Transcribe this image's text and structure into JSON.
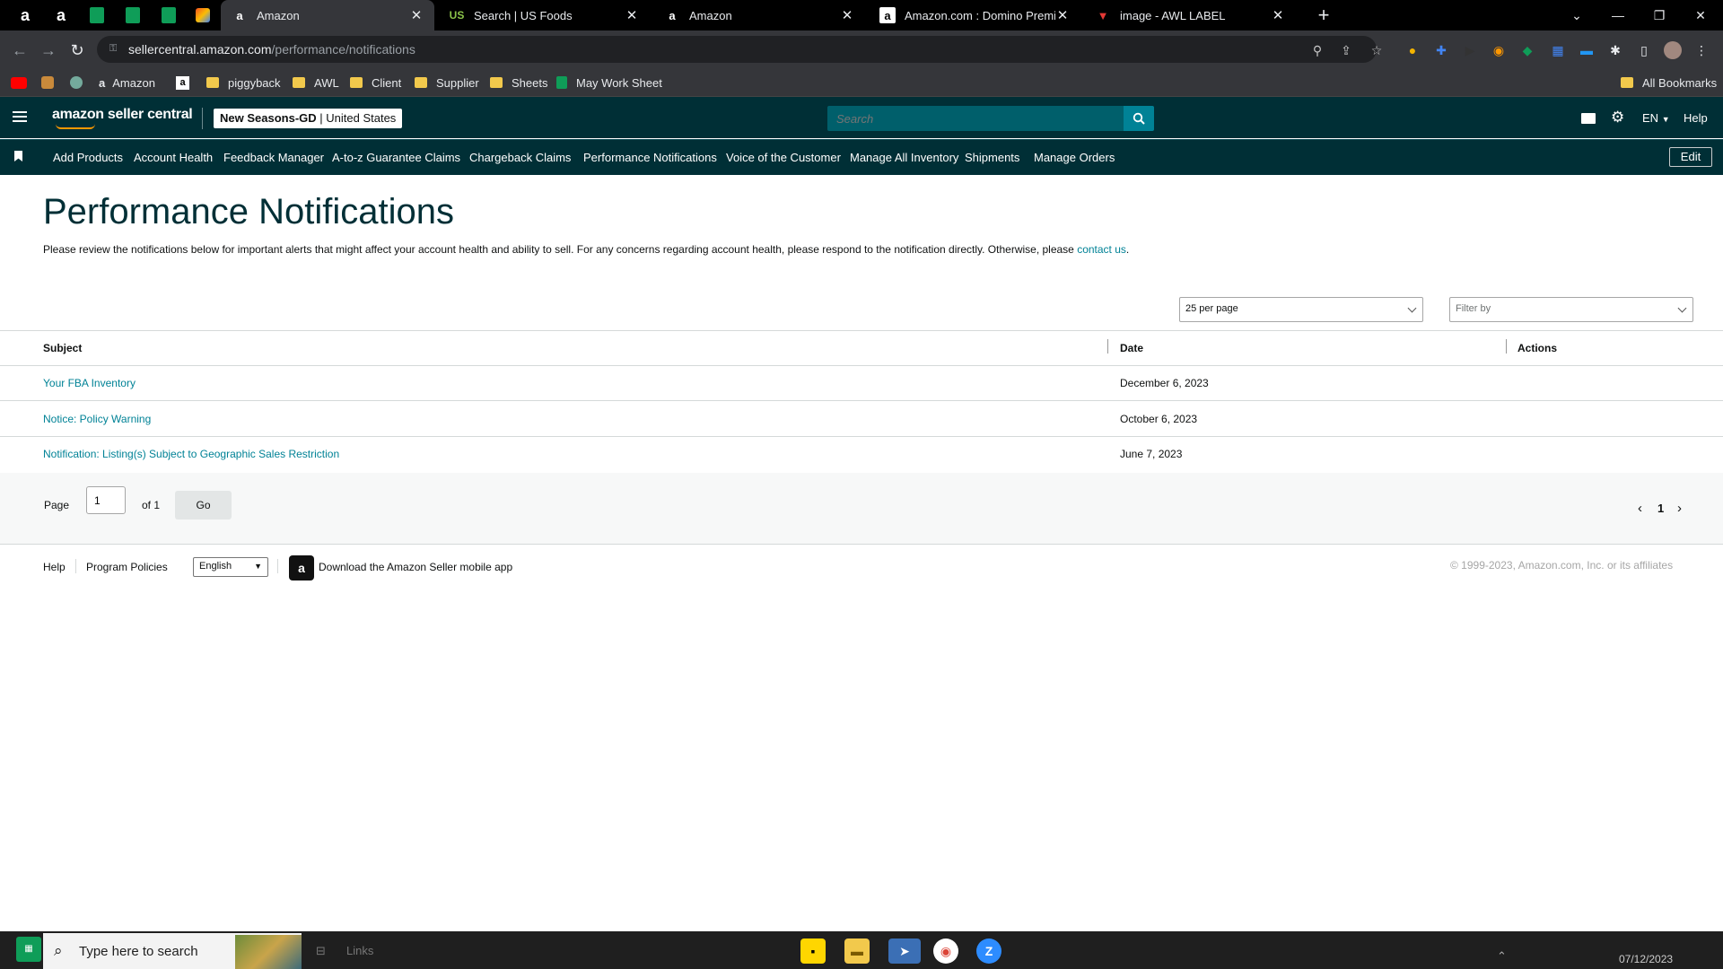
{
  "browser": {
    "tabs": [
      {
        "title": "Amazon",
        "favicon": "amazon-a",
        "active": true
      },
      {
        "title": "Search | US Foods",
        "favicon": "us-foods"
      },
      {
        "title": "Amazon",
        "favicon": "amazon-a"
      },
      {
        "title": "Amazon.com : Domino Premiu",
        "favicon": "amazon-a-box"
      },
      {
        "title": "image - AWL LABEL",
        "favicon": "awl-logo"
      }
    ],
    "new_tab": "+",
    "url_host": "sellercentral.amazon.com",
    "url_path": "/performance/notifications",
    "bookmarks": [
      {
        "label": "",
        "icon": "youtube-icon"
      },
      {
        "label": "",
        "icon": "app-icon"
      },
      {
        "label": "",
        "icon": "chatgpt-icon"
      },
      {
        "label": "Amazon",
        "icon": "amazon-icon"
      },
      {
        "label": "",
        "icon": "amazon-box-icon"
      },
      {
        "label": "piggyback",
        "icon": "folder-icon"
      },
      {
        "label": "AWL",
        "icon": "folder-icon"
      },
      {
        "label": "Client",
        "icon": "folder-icon"
      },
      {
        "label": "Supplier",
        "icon": "folder-icon"
      },
      {
        "label": "Sheets",
        "icon": "folder-icon"
      },
      {
        "label": "May Work Sheet",
        "icon": "sheets-icon"
      }
    ],
    "all_bookmarks": "All Bookmarks"
  },
  "header": {
    "logo_text": "amazon seller central",
    "store_name": "New Seasons-GD",
    "store_sep": " | ",
    "marketplace": "United States",
    "search_placeholder": "Search",
    "language": "EN",
    "help": "Help"
  },
  "nav": {
    "items": [
      "Add Products",
      "Account Health",
      "Feedback Manager",
      "A-to-z Guarantee Claims",
      "Chargeback Claims",
      "Performance Notifications",
      "Voice of the Customer",
      "Manage All Inventory",
      "Shipments",
      "Manage Orders"
    ],
    "edit_label": "Edit"
  },
  "main": {
    "title": "Performance Notifications",
    "description": "Please review the notifications below for important alerts that might affect your account health and ability to sell. For any concerns regarding account health, please respond to the notification directly. Otherwise, please ",
    "contact_link": "contact us",
    "contact_suffix": ".",
    "per_page": "25 per page",
    "filter_placeholder": "Filter by",
    "table": {
      "headers": [
        "Subject",
        "Date",
        "Actions"
      ],
      "rows": [
        {
          "subject": "Your FBA Inventory",
          "date": "December 6, 2023"
        },
        {
          "subject": "Notice: Policy Warning",
          "date": "October 6, 2023"
        },
        {
          "subject": "Notification: Listing(s) Subject to Geographic Sales Restriction",
          "date": "June 7, 2023"
        }
      ]
    },
    "pager": {
      "page_label": "Page",
      "page_value": "1",
      "of_label": "of 1",
      "go_label": "Go",
      "current": "1"
    }
  },
  "footer": {
    "help": "Help",
    "program_policies": "Program Policies",
    "language": "English",
    "app_download": "Download the Amazon Seller mobile app",
    "copyright": "© 1999-2023, Amazon.com, Inc. or its affiliates"
  },
  "taskbar": {
    "search_placeholder": "Type here to search",
    "links_label": "Links",
    "date": "07/12/2023"
  },
  "colors": {
    "header_bg": "#002f36",
    "link": "#008296",
    "search_bg": "#005f6b",
    "title": "#002f36"
  }
}
